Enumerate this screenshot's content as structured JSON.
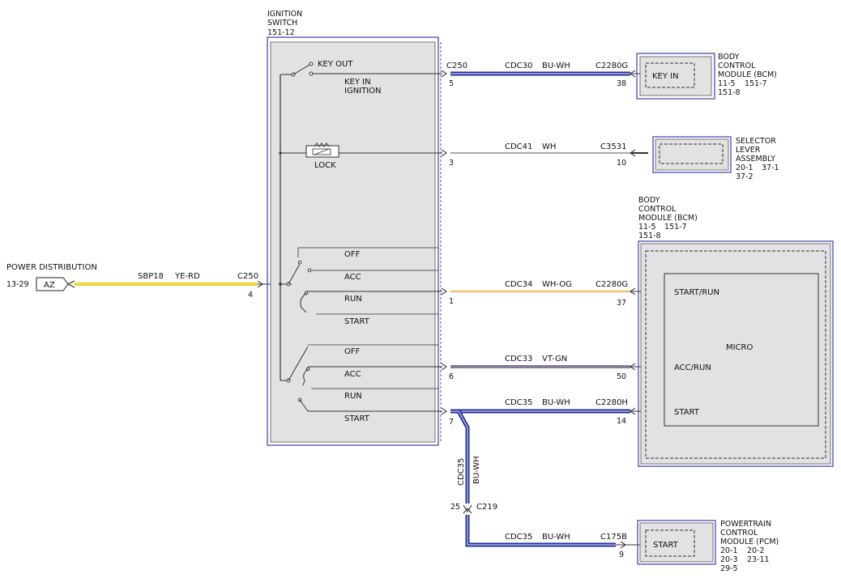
{
  "colors": {
    "harness_blue": "#1f2f9e",
    "harness_white": "#f4f4f8",
    "yellow": "#e8cd1a",
    "red_stripe": "#e05050",
    "orange_stripe": "#f0a030",
    "violet": "#9a68b0",
    "green_stripe": "#5aa85a",
    "component_fill": "#e2e2e2",
    "component_border": "#3a3fa8",
    "wire": "#333333"
  },
  "power": {
    "label": "POWER DISTRIBUTION",
    "ref": "13-29",
    "connector": "AZ",
    "circuit": "SBP18",
    "color": "YE-RD",
    "conn": "C250",
    "pin": "4"
  },
  "ignition": {
    "title1": "IGNITION",
    "title2": "SWITCH",
    "ref": "151-12",
    "key_out": "KEY OUT",
    "key_in1": "KEY IN",
    "key_in2": "IGNITION",
    "lock": "LOCK",
    "pos_off": "OFF",
    "pos_acc": "ACC",
    "pos_run": "RUN",
    "pos_start": "START"
  },
  "wires": {
    "w1": {
      "conn_left": "C250",
      "pin_left": "5",
      "circuit": "CDC30",
      "color": "BU-WH",
      "conn_right": "C2280G",
      "pin_right": "38"
    },
    "w2": {
      "pin_left": "3",
      "circuit": "CDC41",
      "color": "WH",
      "conn_right": "C3531",
      "pin_right": "10"
    },
    "w3": {
      "pin_left": "1",
      "circuit": "CDC34",
      "color": "WH-OG",
      "conn_right": "C2280G",
      "pin_right": "37"
    },
    "w4": {
      "pin_left": "6",
      "circuit": "CDC33",
      "color": "VT-GN",
      "pin_right": "50"
    },
    "w5": {
      "pin_left": "7",
      "circuit": "CDC35",
      "color": "BU-WH",
      "conn_right": "C2280H",
      "pin_right": "14"
    },
    "vertical": {
      "circuit": "CDC35",
      "color": "BU-WH"
    },
    "splice": {
      "conn": "C219",
      "pin": "25"
    },
    "w6": {
      "circuit": "CDC35",
      "color": "BU-WH",
      "conn_right": "C175B",
      "pin_right": "9"
    }
  },
  "bcm_top": {
    "l1": "BODY",
    "l2": "CONTROL",
    "l3": "MODULE (BCM)",
    "r1a": "11-5",
    "r1b": "151-7",
    "r2": "151-8",
    "inner": "KEY IN"
  },
  "selector": {
    "l1": "SELECTOR",
    "l2": "LEVER",
    "l3": "ASSEMBLY",
    "r1a": "20-1",
    "r1b": "37-1",
    "r2": "37-2"
  },
  "bcm_big": {
    "l1": "BODY",
    "l2": "CONTROL",
    "l3": "MODULE (BCM)",
    "r1a": "11-5",
    "r1b": "151-7",
    "r2": "151-8",
    "micro": "MICRO",
    "start_run": "START/RUN",
    "acc_run": "ACC/RUN",
    "start": "START"
  },
  "pcm": {
    "l1": "POWERTRAIN",
    "l2": "CONTROL",
    "l3": "MODULE (PCM)",
    "r1a": "20-1",
    "r1b": "20-2",
    "r2a": "20-3",
    "r2b": "23-11",
    "r3": "29-5",
    "inner": "START"
  }
}
